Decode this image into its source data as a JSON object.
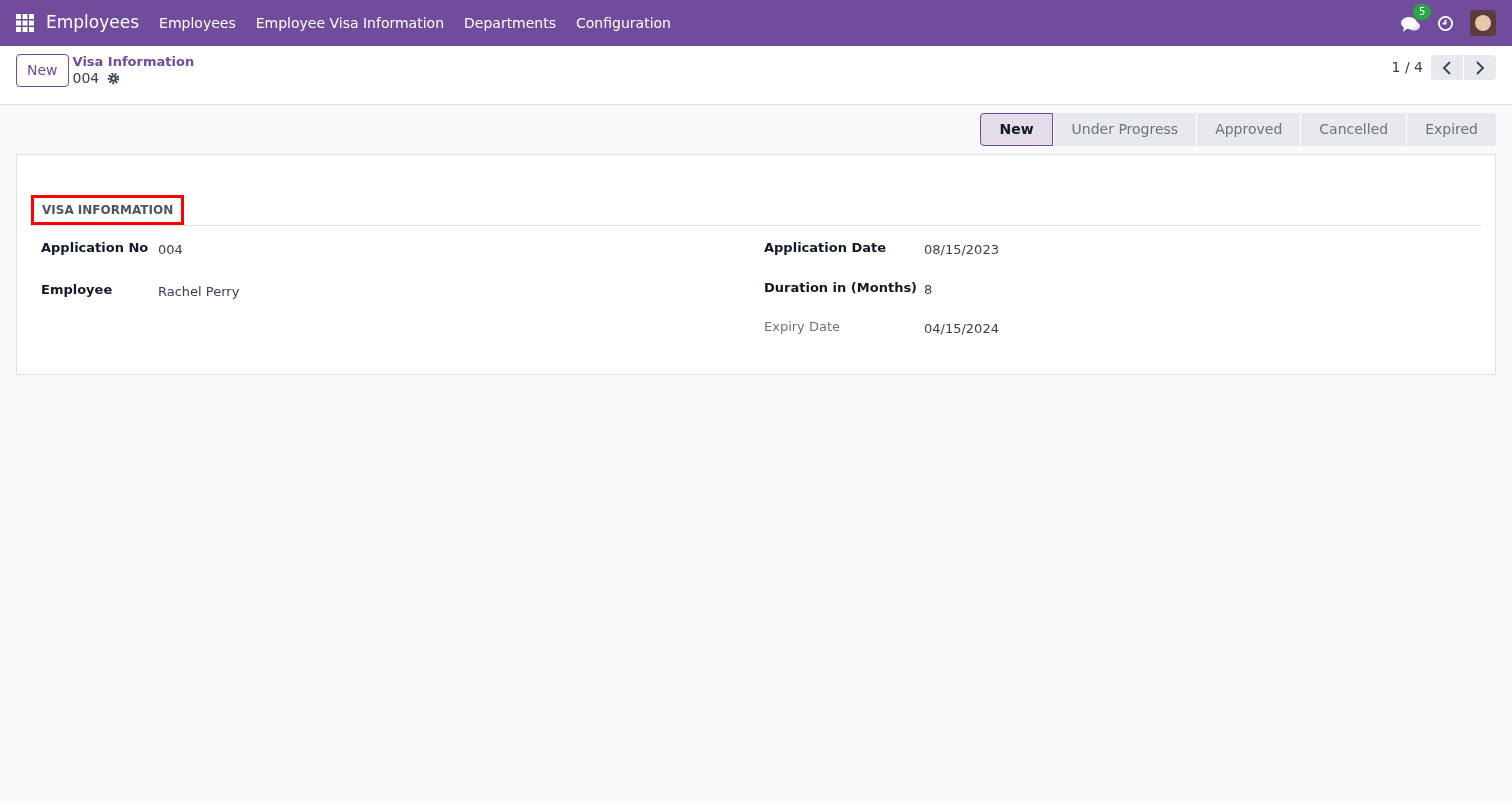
{
  "navbar": {
    "app_name": "Employees",
    "menu": [
      "Employees",
      "Employee Visa Information",
      "Departments",
      "Configuration"
    ],
    "message_count": "5"
  },
  "control_panel": {
    "new_button": "New",
    "breadcrumb": "Visa Information",
    "record_name": "004",
    "pager": "1 / 4"
  },
  "statusbar": [
    {
      "label": "New",
      "selected": true
    },
    {
      "label": "Under Progress",
      "selected": false
    },
    {
      "label": "Approved",
      "selected": false
    },
    {
      "label": "Cancelled",
      "selected": false
    },
    {
      "label": "Expired",
      "selected": false
    }
  ],
  "form": {
    "section_title": "VISA INFORMATION",
    "left_fields": [
      {
        "label": "Application No",
        "value": "004",
        "readonly": false
      },
      {
        "label": "Employee",
        "value": "Rachel Perry",
        "readonly": false
      }
    ],
    "right_fields": [
      {
        "label": "Application Date",
        "value": "08/15/2023",
        "readonly": false
      },
      {
        "label": "Duration in (Months)",
        "value": "8",
        "readonly": false
      },
      {
        "label": "Expiry Date",
        "value": "04/15/2024",
        "readonly": true
      }
    ]
  }
}
